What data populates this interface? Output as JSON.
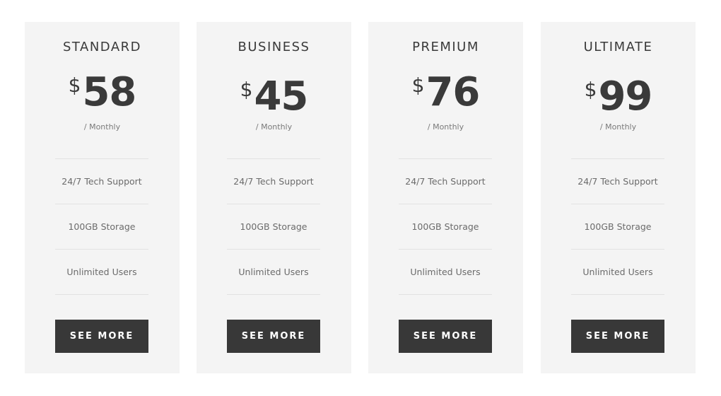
{
  "plans": [
    {
      "name": "STANDARD",
      "currency": "$",
      "amount": "58",
      "period": "/ Monthly",
      "features": [
        "24/7 Tech Support",
        "100GB Storage",
        "Unlimited Users"
      ],
      "button_label": "SEE MORE"
    },
    {
      "name": "BUSINESS",
      "currency": "$",
      "amount": "45",
      "period": "/ Monthly",
      "features": [
        "24/7 Tech Support",
        "100GB Storage",
        "Unlimited Users"
      ],
      "button_label": "SEE MORE"
    },
    {
      "name": "PREMIUM",
      "currency": "$",
      "amount": "76",
      "period": "/ Monthly",
      "features": [
        "24/7 Tech Support",
        "100GB Storage",
        "Unlimited Users"
      ],
      "button_label": "SEE MORE"
    },
    {
      "name": "ULTIMATE",
      "currency": "$",
      "amount": "99",
      "period": "/ Monthly",
      "features": [
        "24/7 Tech Support",
        "100GB Storage",
        "Unlimited Users"
      ],
      "button_label": "SEE MORE"
    }
  ],
  "colors": {
    "card_background": "#f4f4f4",
    "button_background": "#383838",
    "text_dark": "#3a3a3a",
    "text_muted": "#6b6b6b",
    "divider": "#e2e2e2"
  }
}
